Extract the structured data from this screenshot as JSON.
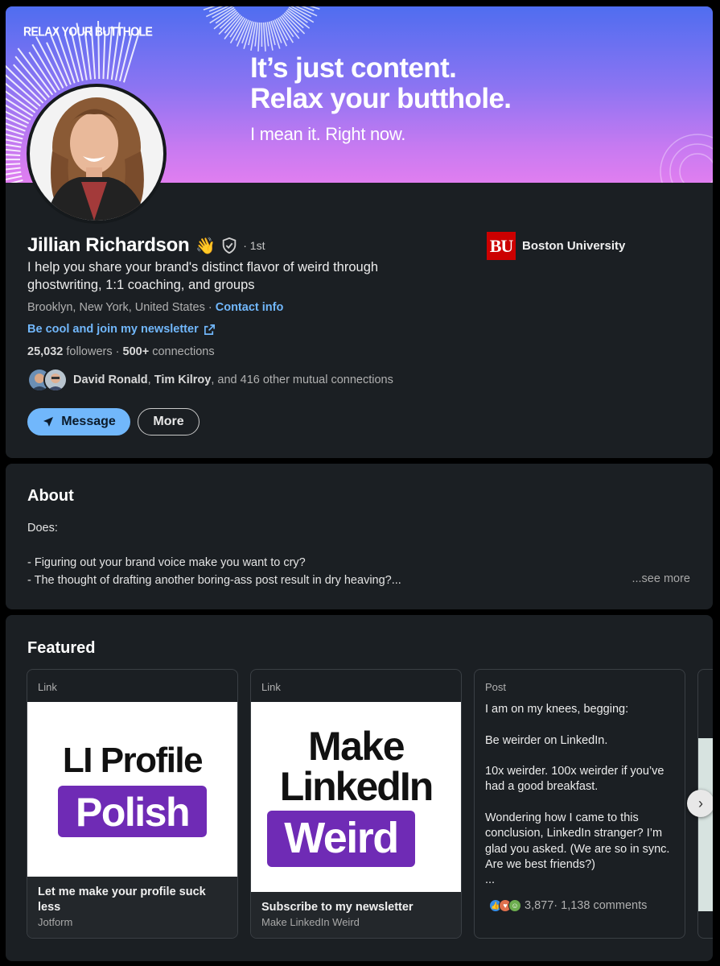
{
  "banner": {
    "tag": "RELAX YOUR BUTTHOLE",
    "headline_line1": "It’s just content.",
    "headline_line2": "Relax your butthole.",
    "subline": "I mean it. Right now."
  },
  "profile": {
    "name": "Jillian Richardson",
    "emoji": "👋",
    "degree": "· 1st",
    "headline": "I help you share your brand's distinct flavor of weird through ghostwriting, 1:1 coaching, and groups",
    "location": "Brooklyn, New York, United States",
    "location_sep": " · ",
    "contact_info": "Contact info",
    "newsletter_link": "Be cool and join my newsletter",
    "followers_count": "25,032",
    "followers_label": " followers",
    "stats_sep": " · ",
    "connections_count": "500+",
    "connections_label": " connections",
    "mutual_name1": "David Ronald",
    "mutual_sep": ", ",
    "mutual_name2": "Tim Kilroy",
    "mutual_rest": ", and 416 other mutual connections",
    "message_label": "Message",
    "more_label": "More",
    "school_logo_text": "BU",
    "school": "Boston University"
  },
  "about": {
    "title": "About",
    "text": "Does:\n\n- Figuring out your brand voice make you want to cry?\n- The thought of drafting another boring-ass post result in dry heaving?...",
    "see_more": "...see more"
  },
  "featured": {
    "title": "Featured",
    "items": [
      {
        "kind": "Link",
        "image_line1": "LI Profile",
        "image_line2": "Polish",
        "title": "Let me make your profile suck less",
        "subtitle": "Jotform"
      },
      {
        "kind": "Link",
        "image_line1": "Make",
        "image_line2": "LinkedIn",
        "image_line3": "Weird",
        "title": "Subscribe to my newsletter",
        "subtitle": "Make LinkedIn Weird"
      },
      {
        "kind": "Post",
        "text": "I am on my knees, begging:\n\n Be weirder on LinkedIn.\n\n10x weirder. 100x weirder if you’ve had a good breakfast.\n\nWondering how I came to this conclusion, LinkedIn stranger? I’m glad you asked. (We are so in sync. Are we best friends?)\n...",
        "reactions": "3,877",
        "comments": " · 1,138 comments"
      }
    ],
    "next_icon": "›"
  },
  "colors": {
    "accent": "#71b7fb",
    "card_bg": "#1b1f23",
    "page_bg": "#000000",
    "purple": "#6f2bb5",
    "bu_red": "#cc0000"
  },
  "icons": [
    "verified-shield-icon",
    "external-link-icon",
    "send-icon",
    "chevron-right-icon",
    "like-reaction-icon",
    "love-reaction-icon",
    "support-reaction-icon"
  ]
}
